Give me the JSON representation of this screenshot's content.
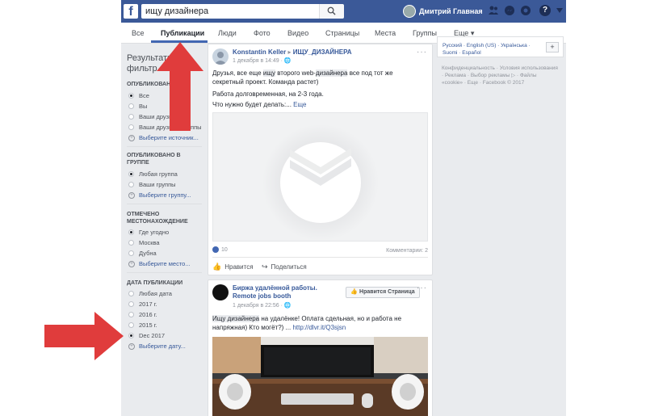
{
  "search": {
    "value": "ищу дизайнера"
  },
  "topbar": {
    "user_name": "Дмитрий",
    "home_label": "Главная"
  },
  "tabs": [
    {
      "label": "Все"
    },
    {
      "label": "Публикации"
    },
    {
      "label": "Люди"
    },
    {
      "label": "Фото"
    },
    {
      "label": "Видео"
    },
    {
      "label": "Страницы"
    },
    {
      "label": "Места"
    },
    {
      "label": "Группы"
    },
    {
      "label": "Еще ▾"
    }
  ],
  "sidebar": {
    "title_line1": "Результаты",
    "title_line2": "фильтр",
    "published_head": "ОПУБЛИКОВАНО",
    "published_options": [
      "Все",
      "Вы",
      "Ваши друзья",
      "Ваши друзья и группы",
      "Выберите источник..."
    ],
    "group_head_line1": "ОПУБЛИКОВАНО В",
    "group_head_line2": "ГРУППЕ",
    "group_options": [
      "Любая группа",
      "Ваши группы",
      "Выберите группу..."
    ],
    "location_head_line1": "ОТМЕЧЕНО",
    "location_head_line2": "МЕСТОНАХОЖДЕНИЕ",
    "location_options": [
      "Где угодно",
      "Москва",
      "Дубна",
      "Выберите место..."
    ],
    "date_head": "ДАТА ПУБЛИКАЦИИ",
    "date_options": [
      "Любая дата",
      "2017 г.",
      "2016 г.",
      "2015 г.",
      "Dec 2017",
      "Выберите дату..."
    ]
  },
  "post1": {
    "author": "Konstantin Keller",
    "group": "ИЩУ_ДИЗАЙНЕРА",
    "meta": "1 декабря в 14:49 · 🌐",
    "line1_a": "Друзья, все еще ",
    "line1_hl": "ищу",
    "line1_b": " второго web-",
    "line1_hl2": "дизайнера",
    "line1_c": " все под тот же",
    "line2": "секретный проект. Команда растет)",
    "line3": "Работа долговременная, на 2-3 года.",
    "line4": "Что нужно будет делать:...",
    "more": "Еще",
    "likes_count": "10",
    "comments": "Комментарии: 2",
    "like_btn": "Нравится",
    "share_btn": "Поделиться"
  },
  "post2": {
    "author_line1": "Биржа удалённой работы.",
    "author_line2": "Remote jobs booth",
    "meta": "1 декабря в 22:56 · 🌐",
    "like_page_btn": "Нравится Страница",
    "text_hl": "Ищу дизайнера",
    "text_a": " на удалёнке! Оплата сдельная, но и работа не",
    "text_b": "напряжная) Кто могёт?) ... ",
    "link": "http://dlvr.it/Q3sjsn"
  },
  "right": {
    "langs": "Русский · English (US) · Українська · Suomi · Español",
    "add_label": "+",
    "footer": "Конфиденциальность · Условия использования · Реклама · Выбор рекламы ▷ · Файлы «cookie» · Еще · Facebook © 2017"
  },
  "colors": {
    "fb_blue": "#3b5998",
    "link": "#365899",
    "arrow_red": "#e03c3c"
  }
}
